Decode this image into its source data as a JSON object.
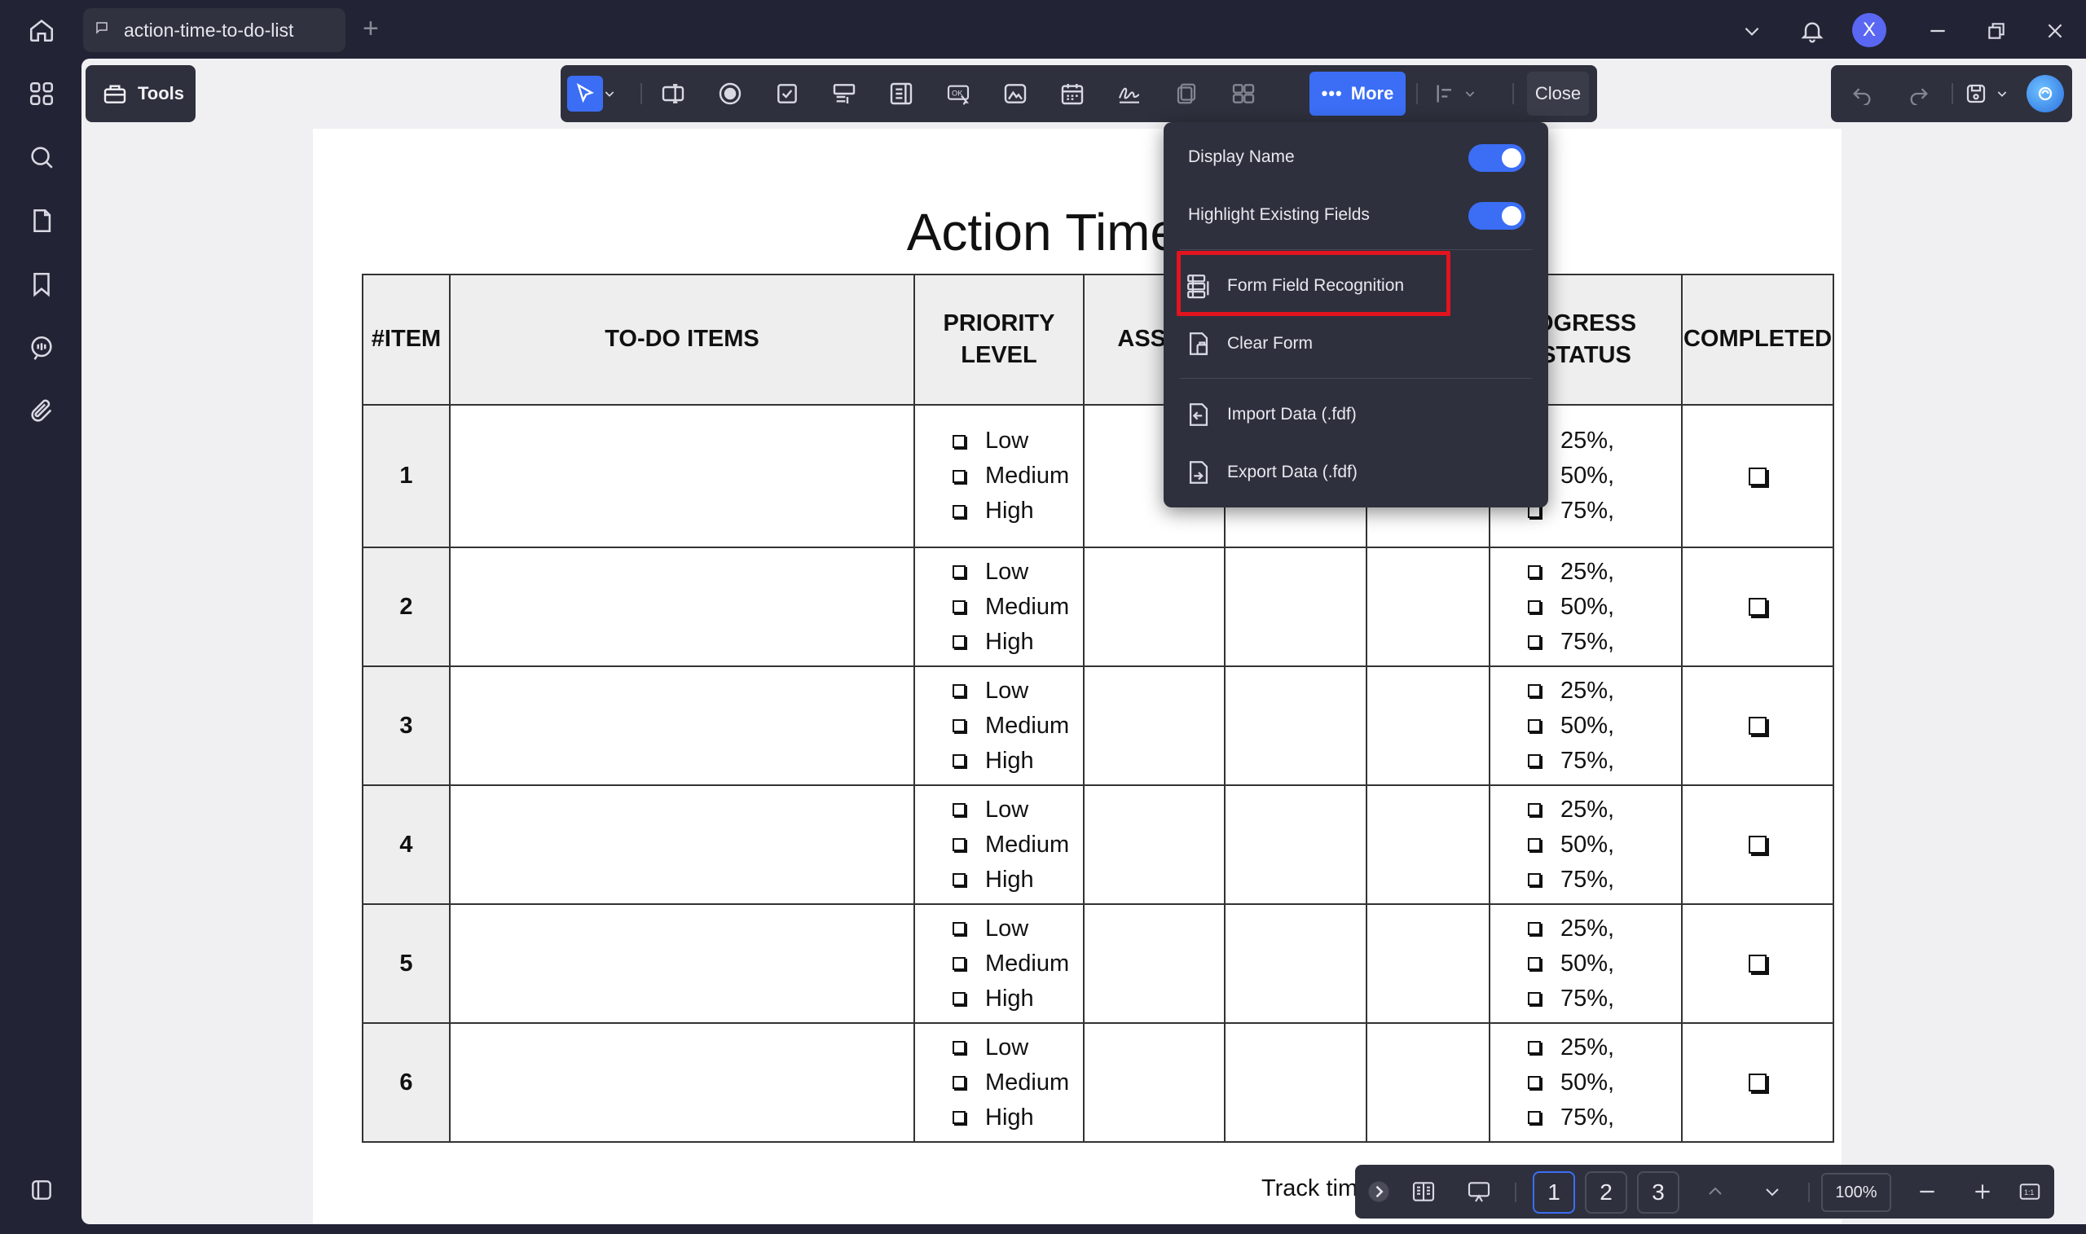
{
  "tab": {
    "title": "action-time-to-do-list"
  },
  "window": {
    "avatar_letter": "X"
  },
  "tools": {
    "label": "Tools"
  },
  "toolbar": {
    "more_label": "More",
    "close_label": "Close"
  },
  "menu": {
    "display_name": "Display Name",
    "highlight_fields": "Highlight Existing Fields",
    "form_field_recognition": "Form Field Recognition",
    "clear_form": "Clear Form",
    "import_data": "Import Data (.fdf)",
    "export_data": "Export Data (.fdf)",
    "display_name_on": true,
    "highlight_fields_on": true
  },
  "document": {
    "title_visible": "Action Time To",
    "columns": [
      "#ITEM",
      "TO-DO ITEMS",
      "PRIORITY LEVEL",
      "ASSIG",
      "",
      "",
      "OGRESS STATUS",
      "COMPLETED"
    ],
    "priority_options": [
      "Low",
      "Medium",
      "High"
    ],
    "progress_options": [
      "25%,",
      "50%,",
      "75%,"
    ],
    "rows": [
      "1",
      "2",
      "3",
      "4",
      "5",
      "6"
    ],
    "footer_text": "Track tim"
  },
  "pagebar": {
    "pages": [
      "1",
      "2",
      "3"
    ],
    "current_page": "1",
    "zoom": "100%"
  },
  "colors": {
    "accent": "#3b6ef5",
    "highlight": "#e1141f",
    "panel": "#2e303d",
    "chrome": "#222435"
  }
}
